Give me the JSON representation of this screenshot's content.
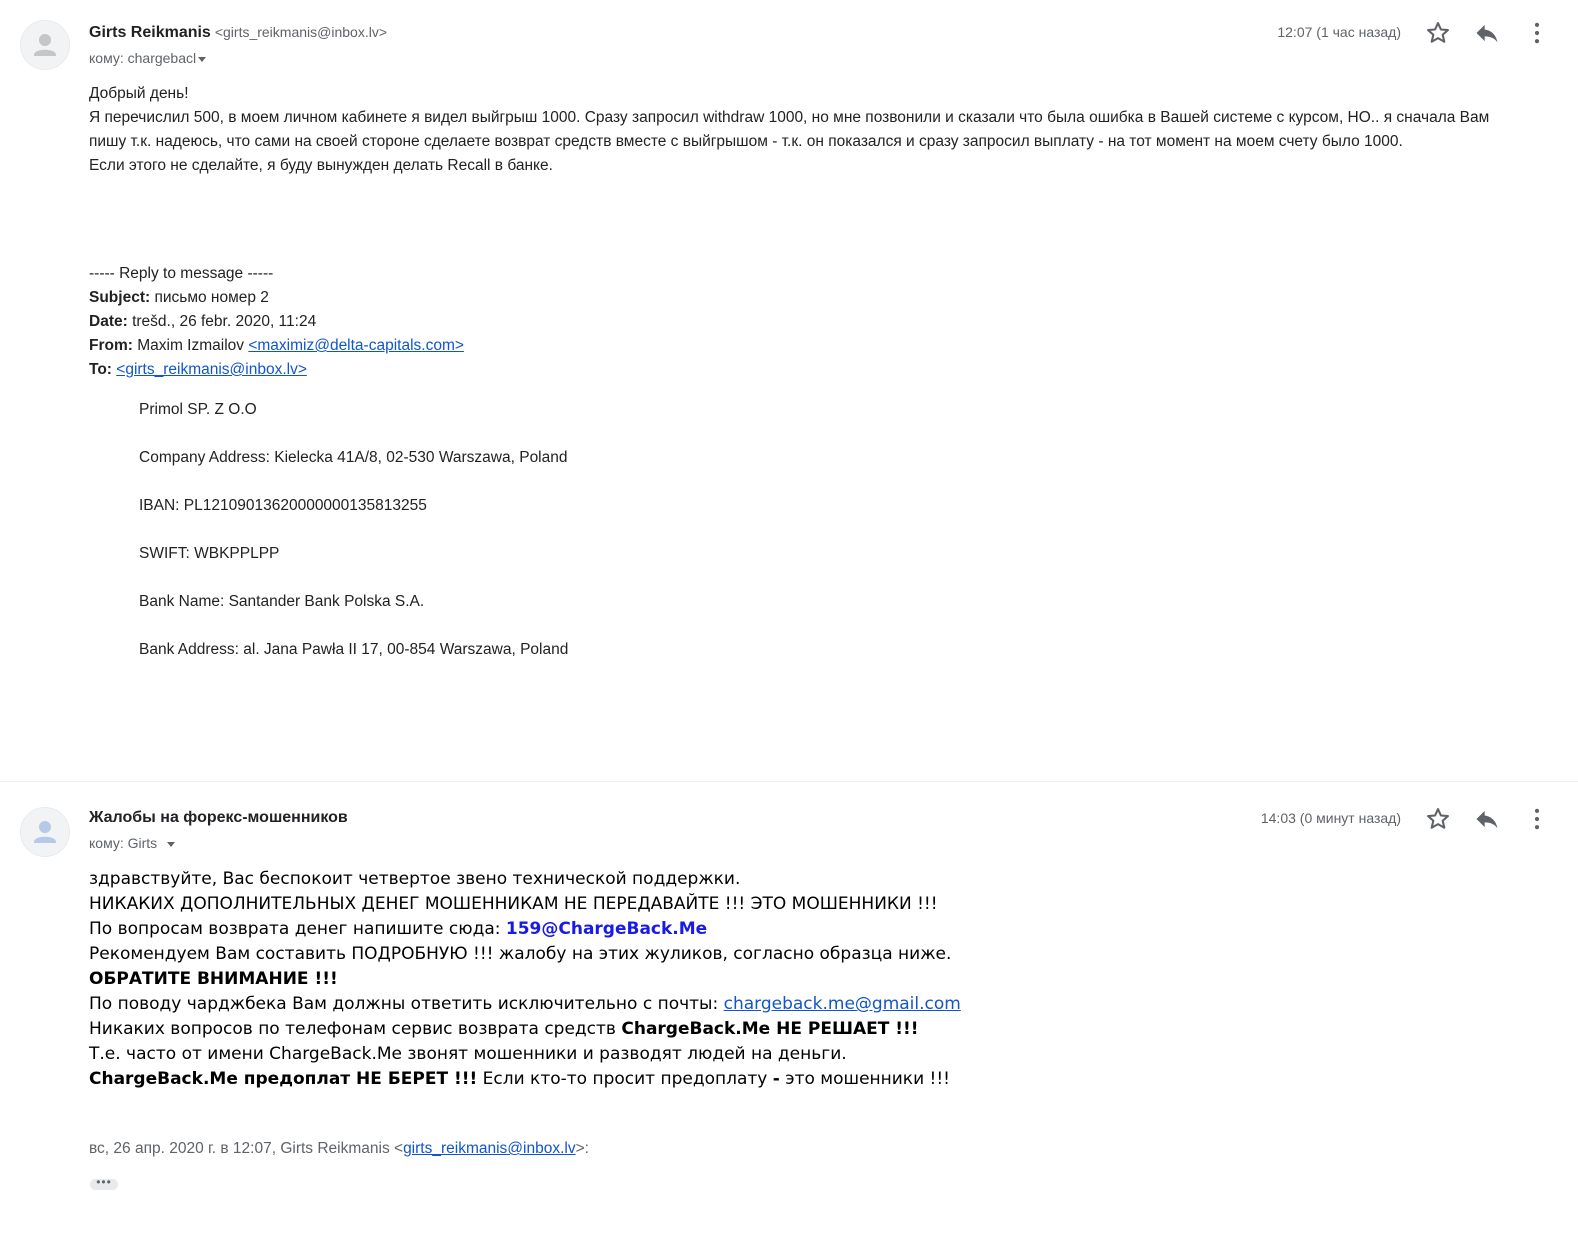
{
  "message1": {
    "sender_name": "Girts Reikmanis",
    "sender_email": "<girts_reikmanis@inbox.lv>",
    "to_label": "кому: chargebacl",
    "time": "12:07 (1 час назад)",
    "icons": {
      "star": "star-icon",
      "reply": "reply-icon",
      "more": "more-vert-icon",
      "avatar": "person-icon"
    },
    "greeting": "Добрый день!",
    "para1_line1": "Я перечислил 500, в моем личном кабинете я видел выйгрыш 1000. Сразу запросил withdraw 1000, но мне позвонили и сказали что была ошибка в Вашей системе с курсом, НО.. я сначала Вам",
    "para1_line2": "пишу т.к. надеюсь, что сами на своей стороне сделаете возврат средств вместе с выйгрышом - т.к. он показался и сразу запросил выплату - на тот момент на моем счету было 1000.",
    "para2": "Если этого не сделайте, я буду вынужден делать Recall в банке.",
    "reply_divider": "----- Reply to message -----",
    "subject_label": "Subject:",
    "subject_value": " письмо номер 2",
    "date_label": "Date:",
    "date_value": " trešd., 26 febr. 2020, 11:24",
    "from_label": "From:",
    "from_name": " Maxim Izmailov ",
    "from_email": "<maximiz@delta-capitals.com>",
    "to_field_label": "To:",
    "to_field_email": "<girts_reikmanis@inbox.lv>",
    "company_lines": [
      "Primol SP. Z O.O",
      "Company Address: Kielecka 41A/8, 02-530 Warszawa, Poland",
      "IBAN: PL12109013620000000135813255",
      "SWIFT: WBKPPLPP",
      "Bank Name: Santander Bank Polska S.A.",
      "Bank Address: al. Jana Pawła II 17, 00-854 Warszawa, Poland"
    ]
  },
  "message2": {
    "sender_name": "Жалобы на форекс-мошенников",
    "to_label": "кому: Girts",
    "time": "14:03 (0 минут назад)",
    "line1": "здравствуйте, Вас беспокоит четвертое звено технической поддержки.",
    "line2": "НИКАКИХ ДОПОЛНИТЕЛЬНЫХ ДЕНЕГ МОШЕННИКАМ НЕ ПЕРЕДАВАЙТЕ !!! ЭТО МОШЕННИКИ !!!",
    "line3_text": "По вопросам возврата денег напишите сюда: ",
    "line3_email": "159@ChargeBack.Me",
    "line4": "Рекомендуем Вам составить ПОДРОБНУЮ !!! жалобу на этих жуликов, согласно образца ниже.",
    "line5": "ОБРАТИТЕ ВНИМАНИЕ !!!",
    "line6_text": "По поводу чарджбека Вам должны ответить исключительно с почты: ",
    "line6_email": "chargeback.me@gmail.com",
    "line7_text": "Никаких вопросов по телефонам сервис возврата средств ",
    "line7_bold": "ChargeBack.Me НЕ РЕШАЕТ !!!",
    "line8": "Т.е. часто от имени ChargeBack.Me звонят мошенники и разводят людей на деньги.",
    "line9_bold": "ChargeBack.Me предоплат НЕ БЕРЕТ !!!",
    "line9_text": " Если кто-то просит предоплату ",
    "line9_dash": "-",
    "line9_end": " это мошенники !!!",
    "quoted_prefix": "вс, 26 апр. 2020 г. в 12:07, Girts Reikmanis <",
    "quoted_email": "girts_reikmanis@inbox.lv",
    "quoted_suffix": ">:",
    "ellipsis": "•••"
  }
}
